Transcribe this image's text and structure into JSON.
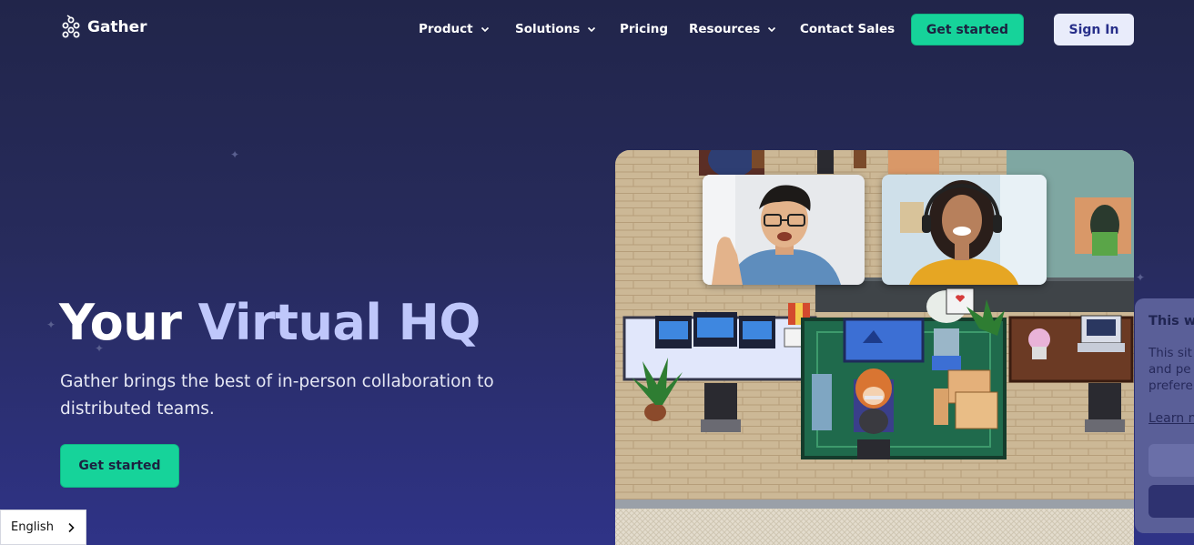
{
  "header": {
    "logo_text": "Gather",
    "nav": [
      {
        "label": "Product",
        "has_dropdown": true
      },
      {
        "label": "Solutions",
        "has_dropdown": true
      },
      {
        "label": "Pricing",
        "has_dropdown": false
      },
      {
        "label": "Resources",
        "has_dropdown": true
      },
      {
        "label": "Contact Sales",
        "has_dropdown": false
      }
    ],
    "get_started_label": "Get started",
    "sign_in_label": "Sign In"
  },
  "hero": {
    "title_part1": "Your",
    "title_part2": "Virtual HQ",
    "subtitle": "Gather brings the best of in-person collaboration to distributed teams.",
    "cta_label": "Get started"
  },
  "language_selector": {
    "value": "English"
  },
  "cookie_banner": {
    "title": "This w",
    "body": "This sit\nand pe\nprefere",
    "link": "Learn n"
  },
  "colors": {
    "accent_green": "#16d39a",
    "background_navy": "#21254a",
    "title_lavender": "#bfc7fb",
    "sign_in_bg": "#e9ecfb"
  },
  "icons": [
    "gather-logo-icon",
    "chevron-down-icon",
    "chevron-right-icon",
    "sparkle-star-icon"
  ]
}
